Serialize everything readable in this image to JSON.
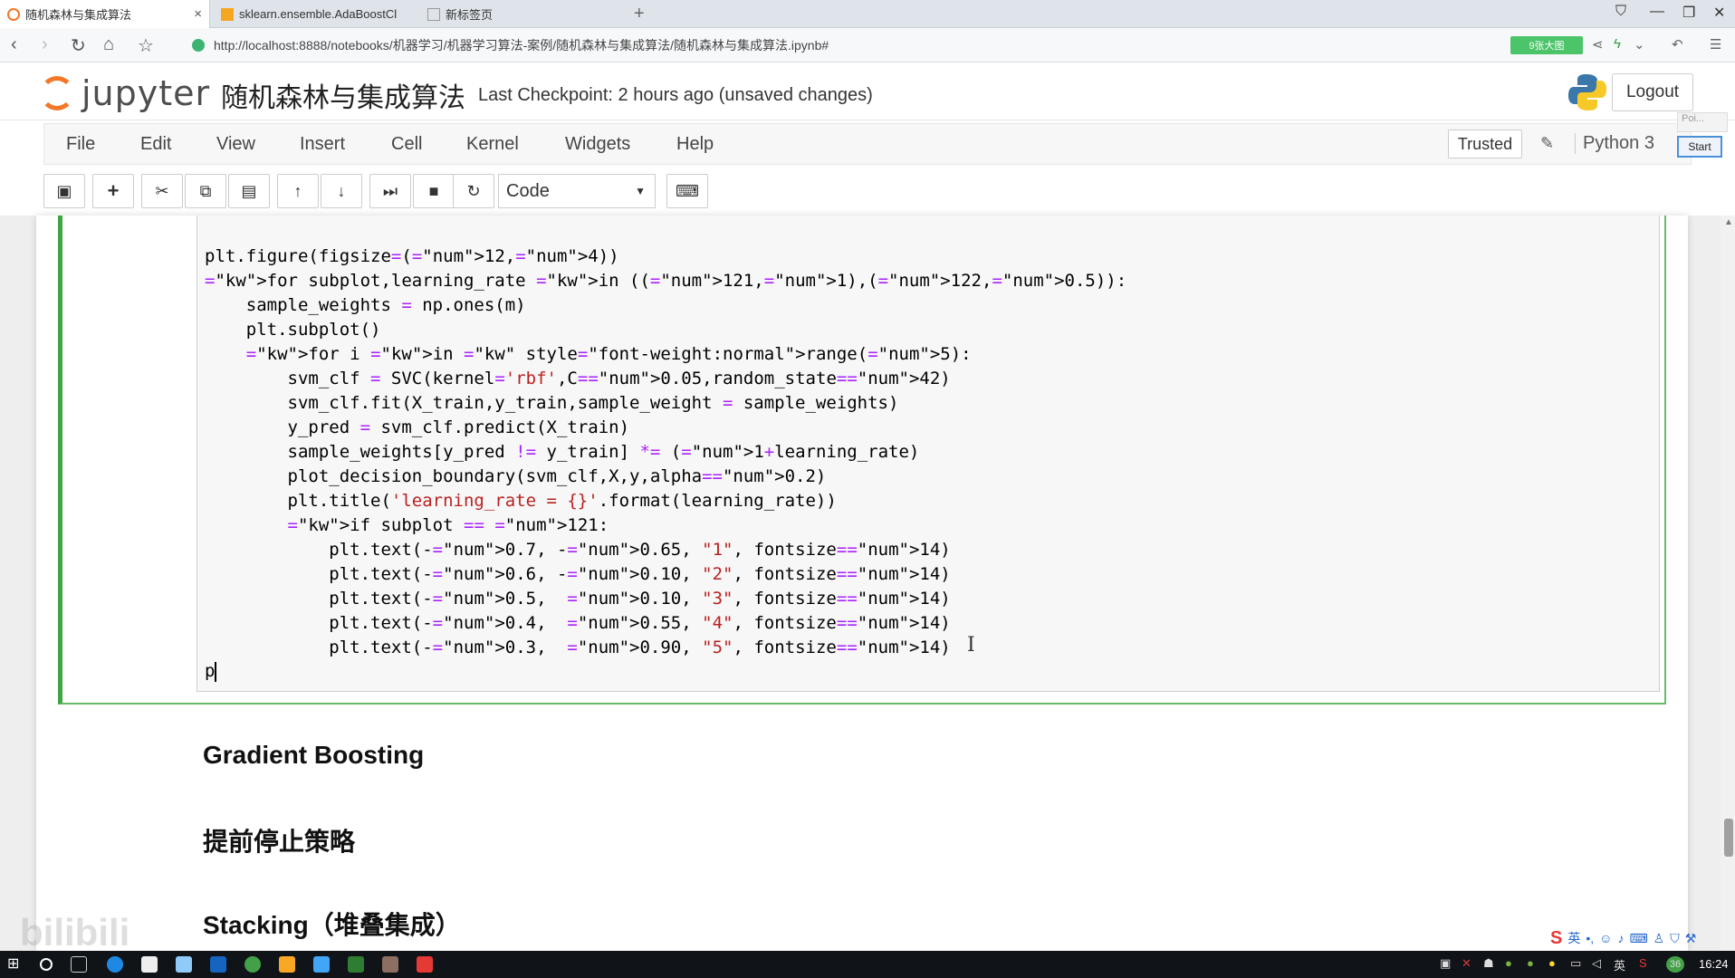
{
  "browser": {
    "tabs": [
      {
        "label": "随机森林与集成算法"
      },
      {
        "label": "sklearn.ensemble.AdaBoostCl"
      },
      {
        "label": "新标签页"
      }
    ],
    "url": "http://localhost:8888/notebooks/机器学习/机器学习算法-案例/随机森林与集成算法/随机森林与集成算法.ipynb#",
    "badge": "9张大图"
  },
  "jupyter": {
    "logo_text": "jupyter",
    "notebook_title": "随机森林与集成算法",
    "checkpoint": "Last Checkpoint: 2 hours ago (unsaved changes)",
    "logout": "Logout",
    "menu": [
      "File",
      "Edit",
      "View",
      "Insert",
      "Cell",
      "Kernel",
      "Widgets",
      "Help"
    ],
    "trusted": "Trusted",
    "kernel": "Python 3",
    "popup_poi": "Poi...",
    "popup_start": "Start",
    "cell_type": "Code"
  },
  "code": {
    "lines": [
      "plt.figure(figsize=(12,4))",
      "for subplot,learning_rate in ((121,1),(122,0.5)):",
      "    sample_weights = np.ones(m)",
      "    plt.subplot()",
      "    for i in range(5):",
      "        svm_clf = SVC(kernel='rbf',C=0.05,random_state=42)",
      "        svm_clf.fit(X_train,y_train,sample_weight = sample_weights)",
      "        y_pred = svm_clf.predict(X_train)",
      "        sample_weights[y_pred != y_train] *= (1+learning_rate)",
      "        plot_decision_boundary(svm_clf,X,y,alpha=0.2)",
      "        plt.title('learning_rate = {}'.format(learning_rate))",
      "        if subplot == 121:",
      "            plt.text(-0.7, -0.65, \"1\", fontsize=14)",
      "            plt.text(-0.6, -0.10, \"2\", fontsize=14)",
      "            plt.text(-0.5,  0.10, \"3\", fontsize=14)",
      "            plt.text(-0.4,  0.55, \"4\", fontsize=14)",
      "            plt.text(-0.3,  0.90, \"5\", fontsize=14)"
    ],
    "current_line": "p"
  },
  "markdown": {
    "h1": "Gradient Boosting",
    "h2": "提前停止策略",
    "h3": "Stacking（堆叠集成）"
  },
  "watermark": "bilibili",
  "ime": {
    "lang": "英"
  },
  "taskbar": {
    "lang": "英",
    "badge": "36",
    "time": "16:24"
  },
  "colors": {
    "accent_green": "#42a545",
    "jupyter_orange": "#f37726"
  }
}
